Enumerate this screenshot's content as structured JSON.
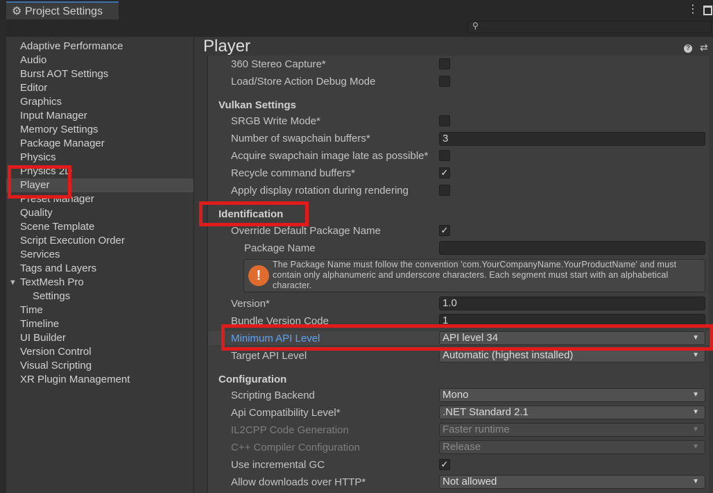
{
  "window": {
    "tab_title": "Project Settings",
    "menu_icon": "⋮",
    "search_placeholder": ""
  },
  "sidebar": {
    "items": [
      {
        "label": "Adaptive Performance"
      },
      {
        "label": "Audio"
      },
      {
        "label": "Burst AOT Settings"
      },
      {
        "label": "Editor"
      },
      {
        "label": "Graphics"
      },
      {
        "label": "Input Manager"
      },
      {
        "label": "Memory Settings"
      },
      {
        "label": "Package Manager"
      },
      {
        "label": "Physics"
      },
      {
        "label": "Physics 2D"
      },
      {
        "label": "Player",
        "selected": true
      },
      {
        "label": "Preset Manager"
      },
      {
        "label": "Quality"
      },
      {
        "label": "Scene Template"
      },
      {
        "label": "Script Execution Order"
      },
      {
        "label": "Services"
      },
      {
        "label": "Tags and Layers"
      },
      {
        "label": "TextMesh Pro",
        "expanded": true
      },
      {
        "label": "Settings"
      },
      {
        "label": "Time"
      },
      {
        "label": "Timeline"
      },
      {
        "label": "UI Builder"
      },
      {
        "label": "Version Control"
      },
      {
        "label": "Visual Scripting"
      },
      {
        "label": "XR Plugin Management"
      }
    ]
  },
  "header": {
    "title": "Player",
    "help_icon": "?"
  },
  "settings": {
    "stereo_capture": {
      "label": "360 Stereo Capture*",
      "checked": false
    },
    "load_store_debug": {
      "label": "Load/Store Action Debug Mode",
      "checked": false
    },
    "vulkan_header": "Vulkan Settings",
    "srgb_write": {
      "label": "SRGB Write Mode*",
      "checked": false
    },
    "swapchain_buffers": {
      "label": "Number of swapchain buffers*",
      "value": "3"
    },
    "acquire_late": {
      "label": "Acquire swapchain image late as possible*",
      "checked": false
    },
    "recycle_buffers": {
      "label": "Recycle command buffers*",
      "checked": true
    },
    "display_rotation": {
      "label": "Apply display rotation during rendering",
      "checked": false
    },
    "identification_header": "Identification",
    "override_package": {
      "label": "Override Default Package Name",
      "checked": true
    },
    "package_name": {
      "label": "Package Name",
      "value": ""
    },
    "package_warning": "The Package Name must follow the convention 'com.YourCompanyName.YourProductName' and must contain only alphanumeric and underscore characters. Each segment must start with an alphabetical character.",
    "version": {
      "label": "Version*",
      "value": "1.0"
    },
    "bundle_code": {
      "label": "Bundle Version Code",
      "value": "1"
    },
    "min_api": {
      "label": "Minimum API Level",
      "value": "API level 34"
    },
    "target_api": {
      "label": "Target API Level",
      "value": "Automatic (highest installed)"
    },
    "configuration_header": "Configuration",
    "scripting_backend": {
      "label": "Scripting Backend",
      "value": "Mono"
    },
    "api_compat": {
      "label": "Api Compatibility Level*",
      "value": ".NET Standard 2.1"
    },
    "il2cpp_gen": {
      "label": "IL2CPP Code Generation",
      "value": "Faster runtime"
    },
    "cpp_compiler": {
      "label": "C++ Compiler Configuration",
      "value": "Release"
    },
    "incremental_gc": {
      "label": "Use incremental GC",
      "checked": true
    },
    "http_downloads": {
      "label": "Allow downloads over HTTP*",
      "value": "Not allowed"
    }
  },
  "icons": {
    "check": "✓",
    "dropdown": "▼",
    "expand": "▼",
    "warning": "!"
  },
  "colors": {
    "highlight_box": "#e01b1b",
    "link_label": "#5fa3f5",
    "warning": "#e06b2e"
  }
}
